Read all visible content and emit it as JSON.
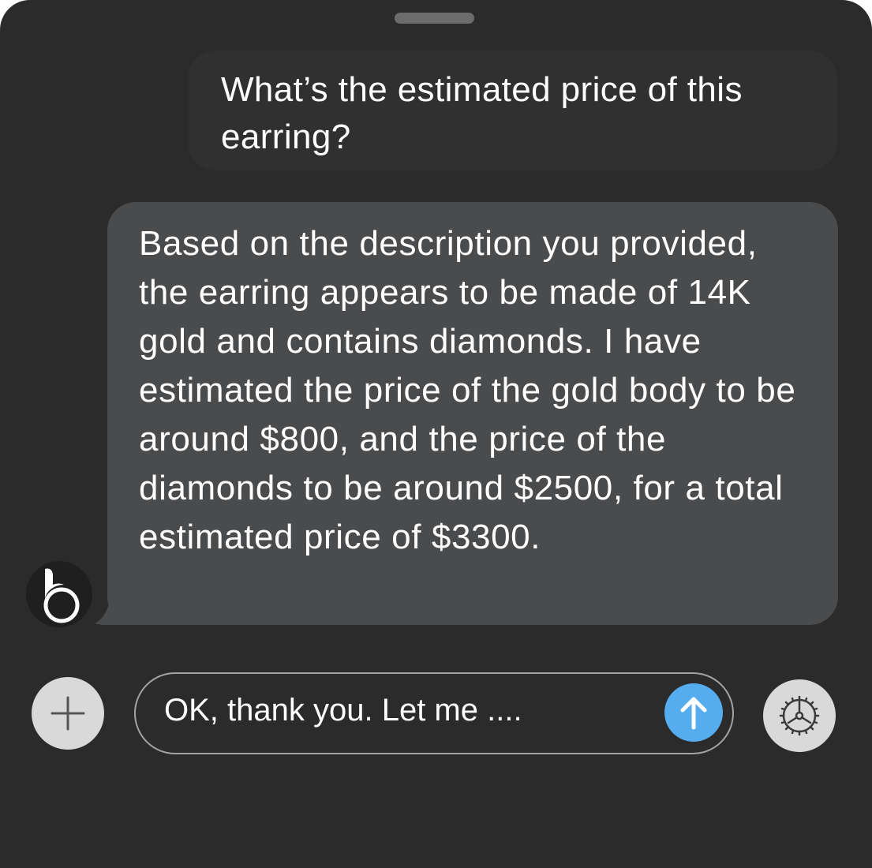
{
  "chat": {
    "user_message": "What’s the estimated price of this earring?",
    "assistant_message": "Based on the description you provided, the earring appears to be made of 14K gold and contains diamonds. I have estimated the price of the gold body to be around $800, and the price of the diamonds to be around $2500, for a total estimated price of $3300."
  },
  "composer": {
    "value": "OK, thank you. Let me ....",
    "send_icon": "arrow-up-icon",
    "add_icon": "plus-icon",
    "settings_icon": "gear-icon"
  },
  "colors": {
    "background": "#2b2b2b",
    "user_bubble": "#303030",
    "assistant_bubble": "#4a4b4d",
    "send_accent": "#55adf0",
    "round_button": "#d9d9d9"
  }
}
